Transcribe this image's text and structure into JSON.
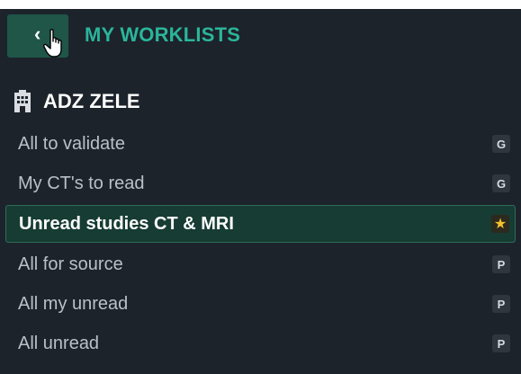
{
  "header": {
    "title": "MY WORKLISTS",
    "back_icon": "chevron-left-icon"
  },
  "group": {
    "name": "ADZ ZELE",
    "icon": "building-icon"
  },
  "worklists": [
    {
      "label": "All to validate",
      "badge": "G",
      "active": false
    },
    {
      "label": "My CT's to read",
      "badge": "G",
      "active": false
    },
    {
      "label": "Unread studies CT & MRI",
      "badge": "★",
      "badge_icon": "star-icon",
      "active": true
    },
    {
      "label": "All for source",
      "badge": "P",
      "active": false
    },
    {
      "label": "All my unread",
      "badge": "P",
      "active": false
    },
    {
      "label": "All unread",
      "badge": "P",
      "active": false
    }
  ],
  "colors": {
    "panel_bg": "#1c232b",
    "accent": "#2bb59a",
    "active_bg": "#163c33",
    "star": "#f2c12e"
  }
}
